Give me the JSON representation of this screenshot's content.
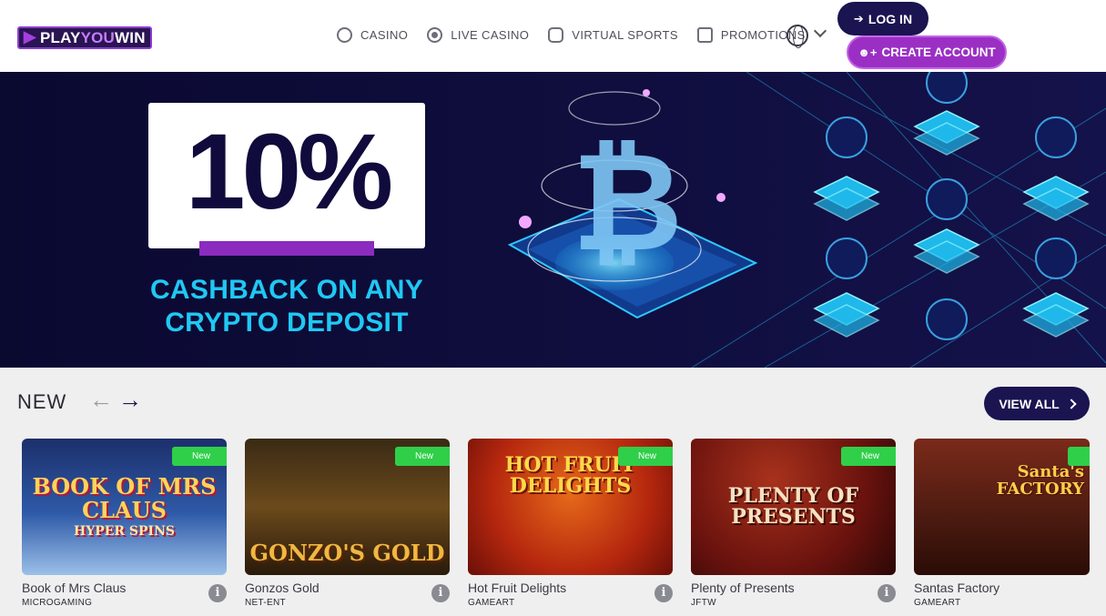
{
  "header": {
    "logo": {
      "part1": "PLAY",
      "part2": "YOU",
      "part3": "WIN"
    },
    "nav": [
      {
        "label": "CASINO",
        "icon": "chip-icon"
      },
      {
        "label": "LIVE CASINO",
        "icon": "live-chip-icon"
      },
      {
        "label": "VIRTUAL SPORTS",
        "icon": "gamepad-icon"
      },
      {
        "label": "PROMOTIONS",
        "icon": "gift-icon"
      }
    ],
    "language_icon": "globe-icon",
    "login_label": "LOG IN",
    "create_label": "CREATE ACCOUNT"
  },
  "banner": {
    "headline": "10%",
    "subline1": "CASHBACK ON ANY",
    "subline2": "CRYPTO DEPOSIT",
    "accent": "#20c8f4"
  },
  "section": {
    "title": "NEW",
    "view_all_label": "VIEW ALL"
  },
  "games": [
    {
      "name": "Book of Mrs Claus",
      "provider": "MICROGAMING",
      "badge": "New",
      "art": "BOOK OF MRS CLAUS",
      "art2": "HYPER SPINS"
    },
    {
      "name": "Gonzos Gold",
      "provider": "NET-ENT",
      "badge": "New",
      "art": "GONZO'S GOLD",
      "art2": ""
    },
    {
      "name": "Hot Fruit Delights",
      "provider": "GAMEART",
      "badge": "New",
      "art": "HOT FRUIT",
      "art2": "DELIGHTS"
    },
    {
      "name": "Plenty of Presents",
      "provider": "JFTW",
      "badge": "New",
      "art": "PLENTY OF",
      "art2": "PRESENTS"
    },
    {
      "name": "Santas Factory",
      "provider": "GAMEART",
      "badge": "N",
      "art": "Santa's",
      "art2": "FACTORY"
    }
  ],
  "colors": {
    "brand_dark": "#1a1450",
    "brand_purple": "#9b2fc4",
    "badge_green": "#2fcf4a"
  }
}
